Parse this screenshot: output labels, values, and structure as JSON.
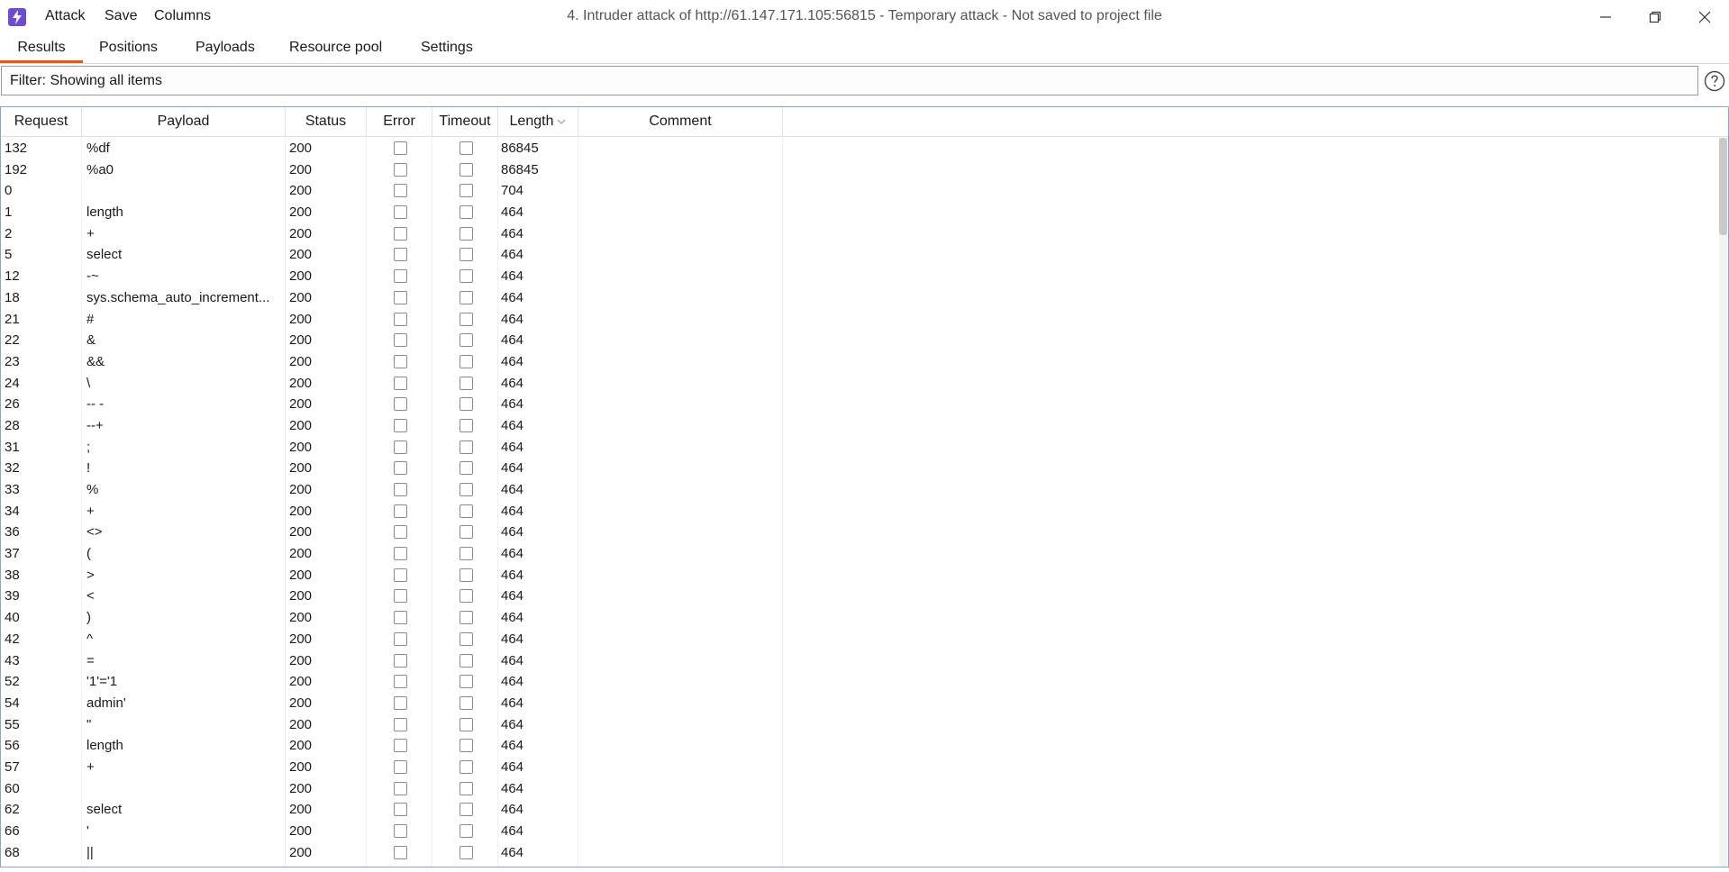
{
  "window": {
    "title": "4. Intruder attack of http://61.147.171.105:56815 - Temporary attack - Not saved to project file",
    "menu": [
      "Attack",
      "Save",
      "Columns"
    ],
    "controls": {
      "minimize_icon": "minimize-icon",
      "restore_icon": "restore-icon",
      "close_icon": "close-icon"
    }
  },
  "tabs": [
    {
      "label": "Results",
      "active": true
    },
    {
      "label": "Positions",
      "active": false
    },
    {
      "label": "Payloads",
      "active": false
    },
    {
      "label": "Resource pool",
      "active": false
    },
    {
      "label": "Settings",
      "active": false
    }
  ],
  "filter": {
    "text": "Filter: Showing all items",
    "help_icon": "help-icon"
  },
  "table": {
    "columns": [
      "Request",
      "Payload",
      "Status",
      "Error",
      "Timeout",
      "Length",
      "Comment"
    ],
    "sorted_column": "Length",
    "rows": [
      {
        "request": "132",
        "payload": "%df",
        "status": "200",
        "error": false,
        "timeout": false,
        "length": "86845"
      },
      {
        "request": "192",
        "payload": "%a0",
        "status": "200",
        "error": false,
        "timeout": false,
        "length": "86845"
      },
      {
        "request": "0",
        "payload": "",
        "status": "200",
        "error": false,
        "timeout": false,
        "length": "704"
      },
      {
        "request": "1",
        "payload": "length",
        "status": "200",
        "error": false,
        "timeout": false,
        "length": "464"
      },
      {
        "request": "2",
        "payload": "+",
        "status": "200",
        "error": false,
        "timeout": false,
        "length": "464"
      },
      {
        "request": "5",
        "payload": "select",
        "status": "200",
        "error": false,
        "timeout": false,
        "length": "464"
      },
      {
        "request": "12",
        "payload": "-~",
        "status": "200",
        "error": false,
        "timeout": false,
        "length": "464"
      },
      {
        "request": "18",
        "payload": "sys.schema_auto_increment...",
        "status": "200",
        "error": false,
        "timeout": false,
        "length": "464"
      },
      {
        "request": "21",
        "payload": "#",
        "status": "200",
        "error": false,
        "timeout": false,
        "length": "464"
      },
      {
        "request": "22",
        "payload": "&",
        "status": "200",
        "error": false,
        "timeout": false,
        "length": "464"
      },
      {
        "request": "23",
        "payload": "&&",
        "status": "200",
        "error": false,
        "timeout": false,
        "length": "464"
      },
      {
        "request": "24",
        "payload": "\\",
        "status": "200",
        "error": false,
        "timeout": false,
        "length": "464"
      },
      {
        "request": "26",
        "payload": "-- -",
        "status": "200",
        "error": false,
        "timeout": false,
        "length": "464"
      },
      {
        "request": "28",
        "payload": "--+",
        "status": "200",
        "error": false,
        "timeout": false,
        "length": "464"
      },
      {
        "request": "31",
        "payload": ";",
        "status": "200",
        "error": false,
        "timeout": false,
        "length": "464"
      },
      {
        "request": "32",
        "payload": "!",
        "status": "200",
        "error": false,
        "timeout": false,
        "length": "464"
      },
      {
        "request": "33",
        "payload": "%",
        "status": "200",
        "error": false,
        "timeout": false,
        "length": "464"
      },
      {
        "request": "34",
        "payload": "+",
        "status": "200",
        "error": false,
        "timeout": false,
        "length": "464"
      },
      {
        "request": "36",
        "payload": "<>",
        "status": "200",
        "error": false,
        "timeout": false,
        "length": "464"
      },
      {
        "request": "37",
        "payload": "(",
        "status": "200",
        "error": false,
        "timeout": false,
        "length": "464"
      },
      {
        "request": "38",
        "payload": ">",
        "status": "200",
        "error": false,
        "timeout": false,
        "length": "464"
      },
      {
        "request": "39",
        "payload": "<",
        "status": "200",
        "error": false,
        "timeout": false,
        "length": "464"
      },
      {
        "request": "40",
        "payload": ")",
        "status": "200",
        "error": false,
        "timeout": false,
        "length": "464"
      },
      {
        "request": "42",
        "payload": "^",
        "status": "200",
        "error": false,
        "timeout": false,
        "length": "464"
      },
      {
        "request": "43",
        "payload": "=",
        "status": "200",
        "error": false,
        "timeout": false,
        "length": "464"
      },
      {
        "request": "52",
        "payload": "'1'='1",
        "status": "200",
        "error": false,
        "timeout": false,
        "length": "464"
      },
      {
        "request": "54",
        "payload": "admin'",
        "status": "200",
        "error": false,
        "timeout": false,
        "length": "464"
      },
      {
        "request": "55",
        "payload": "\"",
        "status": "200",
        "error": false,
        "timeout": false,
        "length": "464"
      },
      {
        "request": "56",
        "payload": "length",
        "status": "200",
        "error": false,
        "timeout": false,
        "length": "464"
      },
      {
        "request": "57",
        "payload": "+",
        "status": "200",
        "error": false,
        "timeout": false,
        "length": "464"
      },
      {
        "request": "60",
        "payload": "",
        "status": "200",
        "error": false,
        "timeout": false,
        "length": "464"
      },
      {
        "request": "62",
        "payload": "select",
        "status": "200",
        "error": false,
        "timeout": false,
        "length": "464"
      },
      {
        "request": "66",
        "payload": "'",
        "status": "200",
        "error": false,
        "timeout": false,
        "length": "464"
      },
      {
        "request": "68",
        "payload": "||",
        "status": "200",
        "error": false,
        "timeout": false,
        "length": "464"
      }
    ]
  },
  "colors": {
    "accent": "#e8590c",
    "logo": "#6c4bd6",
    "selection_border": "#7fa7d8"
  }
}
